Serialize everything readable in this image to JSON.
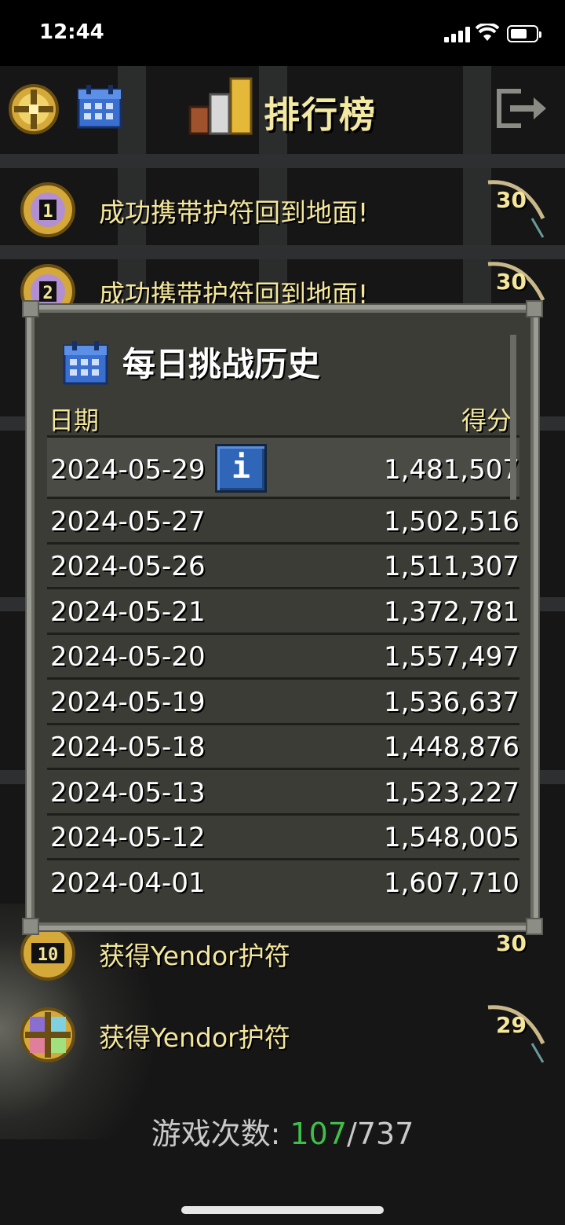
{
  "status_bar": {
    "time": "12:44"
  },
  "header": {
    "title": "排行榜",
    "left_icons": [
      "compass-icon",
      "calendar-icon"
    ],
    "right_icon": "exit-icon"
  },
  "rankings": [
    {
      "rank": "1",
      "label": "成功携带护符回到地面!",
      "score": "30"
    },
    {
      "rank": "2",
      "label": "成功携带护符回到地面!",
      "score": "30"
    },
    {
      "rank": "10",
      "label": "获得Yendor护符",
      "score": "30"
    },
    {
      "rank": "",
      "label": "获得Yendor护符",
      "score": "29"
    }
  ],
  "modal": {
    "title": "每日挑战历史",
    "col_date": "日期",
    "col_score": "得分",
    "info_label": "i",
    "rows": [
      {
        "date": "2024-05-29",
        "score": "1,481,507"
      },
      {
        "date": "2024-05-27",
        "score": "1,502,516"
      },
      {
        "date": "2024-05-26",
        "score": "1,511,307"
      },
      {
        "date": "2024-05-21",
        "score": "1,372,781"
      },
      {
        "date": "2024-05-20",
        "score": "1,557,497"
      },
      {
        "date": "2024-05-19",
        "score": "1,536,637"
      },
      {
        "date": "2024-05-18",
        "score": "1,448,876"
      },
      {
        "date": "2024-05-13",
        "score": "1,523,227"
      },
      {
        "date": "2024-05-12",
        "score": "1,548,005"
      },
      {
        "date": "2024-04-01",
        "score": "1,607,710"
      }
    ]
  },
  "footer": {
    "label": "游戏次数: ",
    "played": "107",
    "sep": "/",
    "total": "737"
  },
  "colors": {
    "accent_text": "#f4e79a",
    "played_green": "#3fbf4a",
    "info_blue": "#2f66b8"
  }
}
